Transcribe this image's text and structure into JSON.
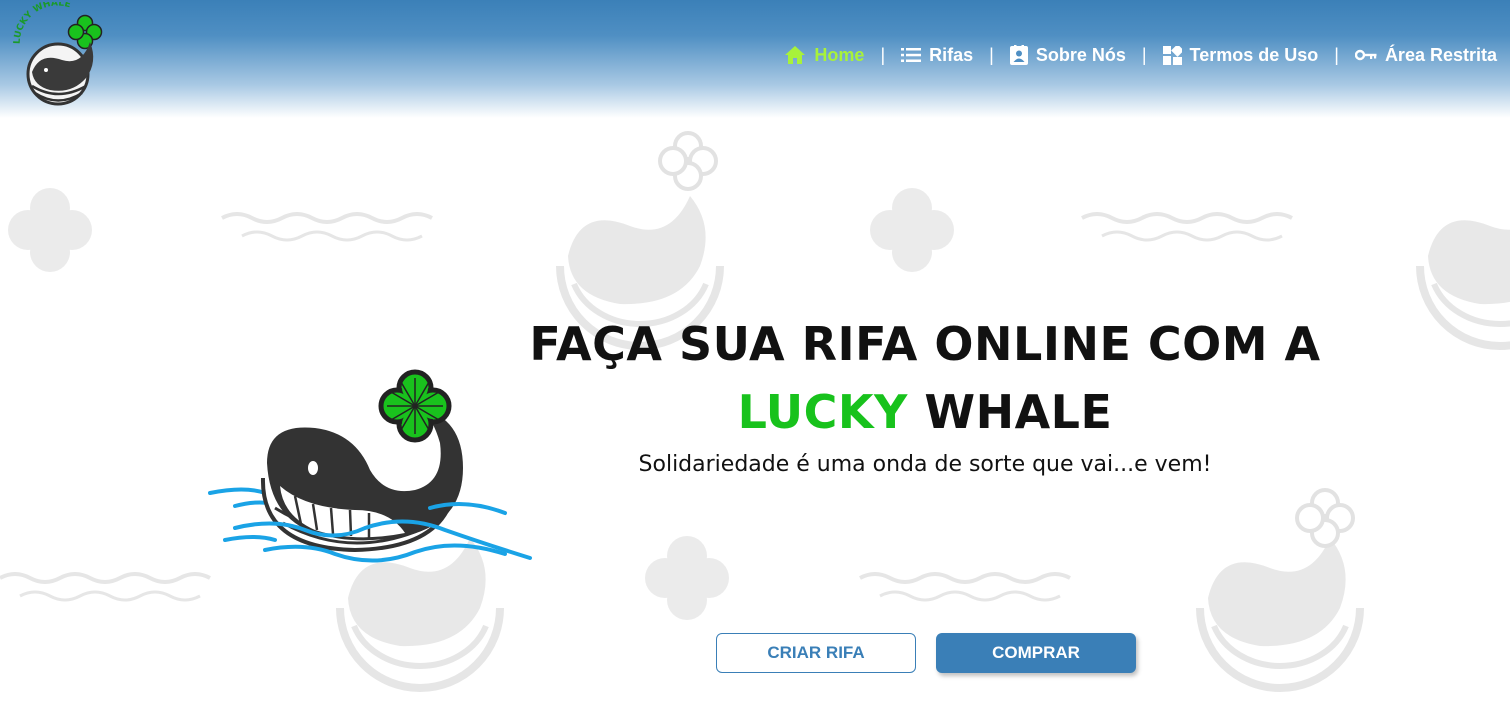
{
  "brand": {
    "logo_text": "LUCKY WHALE"
  },
  "nav": {
    "items": [
      {
        "label": "Home",
        "icon": "home-icon",
        "active": true
      },
      {
        "label": "Rifas",
        "icon": "list-icon",
        "active": false
      },
      {
        "label": "Sobre Nós",
        "icon": "contact-card-icon",
        "active": false
      },
      {
        "label": "Termos de Uso",
        "icon": "dashboard-icon",
        "active": false
      },
      {
        "label": "Área Restrita",
        "icon": "key-icon",
        "active": false
      }
    ],
    "separator": "|"
  },
  "hero": {
    "title_line1": "FAÇA SUA RIFA ONLINE COM A",
    "title_accent": "LUCKY",
    "title_rest": "WHALE",
    "subtitle": "Solidariedade é uma onda de sorte que vai...e vem!"
  },
  "buttons": {
    "create": "CRIAR RIFA",
    "buy": "COMPRAR"
  },
  "colors": {
    "header_blue": "#3b80b8",
    "nav_active": "#a8f23a",
    "accent_green": "#18c21c",
    "button_blue": "#3a7fb7",
    "whale_dark": "#333333",
    "wave_blue": "#1aa3e6",
    "pattern_gray": "#ebebeb"
  }
}
